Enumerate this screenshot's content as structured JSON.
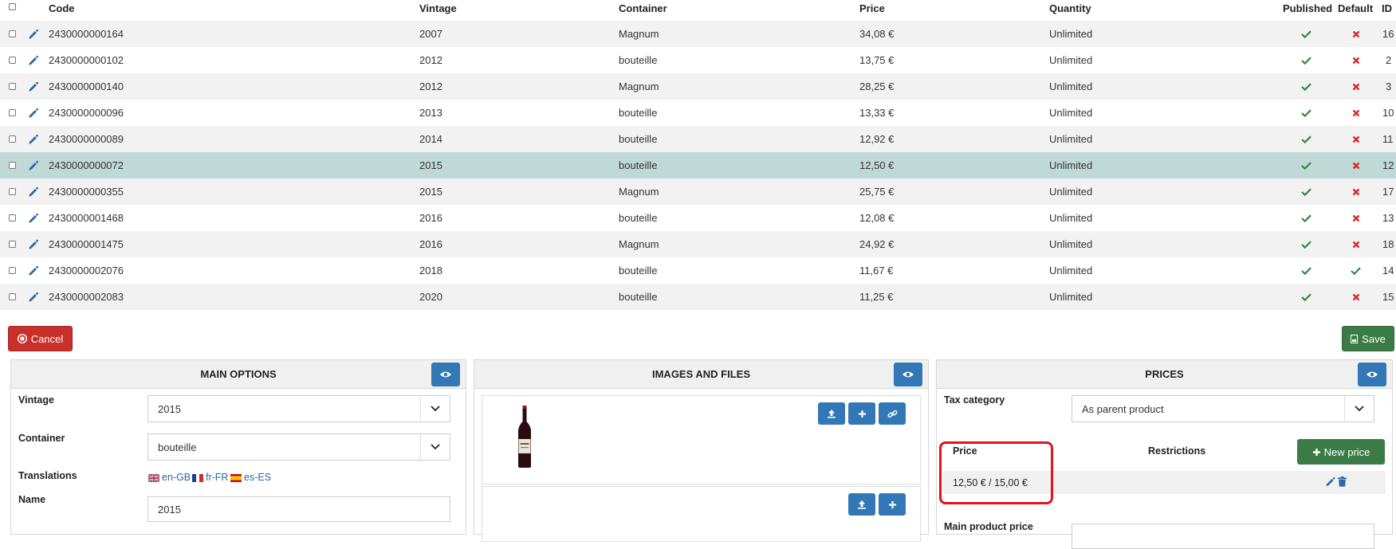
{
  "table": {
    "headers": {
      "code": "Code",
      "vintage": "Vintage",
      "container": "Container",
      "price": "Price",
      "quantity": "Quantity",
      "published": "Published",
      "default": "Default",
      "id": "ID"
    },
    "rows": [
      {
        "code": "2430000000164",
        "vintage": "2007",
        "container": "Magnum",
        "price": "34,08 €",
        "quantity": "Unlimited",
        "published": true,
        "default": false,
        "id": "16"
      },
      {
        "code": "2430000000102",
        "vintage": "2012",
        "container": "bouteille",
        "price": "13,75 €",
        "quantity": "Unlimited",
        "published": true,
        "default": false,
        "id": "2"
      },
      {
        "code": "2430000000140",
        "vintage": "2012",
        "container": "Magnum",
        "price": "28,25 €",
        "quantity": "Unlimited",
        "published": true,
        "default": false,
        "id": "3"
      },
      {
        "code": "2430000000096",
        "vintage": "2013",
        "container": "bouteille",
        "price": "13,33 €",
        "quantity": "Unlimited",
        "published": true,
        "default": false,
        "id": "10"
      },
      {
        "code": "2430000000089",
        "vintage": "2014",
        "container": "bouteille",
        "price": "12,92 €",
        "quantity": "Unlimited",
        "published": true,
        "default": false,
        "id": "11"
      },
      {
        "code": "2430000000072",
        "vintage": "2015",
        "container": "bouteille",
        "price": "12,50 €",
        "quantity": "Unlimited",
        "published": true,
        "default": false,
        "id": "12",
        "selected": true
      },
      {
        "code": "2430000000355",
        "vintage": "2015",
        "container": "Magnum",
        "price": "25,75 €",
        "quantity": "Unlimited",
        "published": true,
        "default": false,
        "id": "17"
      },
      {
        "code": "2430000001468",
        "vintage": "2016",
        "container": "bouteille",
        "price": "12,08 €",
        "quantity": "Unlimited",
        "published": true,
        "default": false,
        "id": "13"
      },
      {
        "code": "2430000001475",
        "vintage": "2016",
        "container": "Magnum",
        "price": "24,92 €",
        "quantity": "Unlimited",
        "published": true,
        "default": false,
        "id": "18"
      },
      {
        "code": "2430000002076",
        "vintage": "2018",
        "container": "bouteille",
        "price": "11,67 €",
        "quantity": "Unlimited",
        "published": true,
        "default": true,
        "id": "14"
      },
      {
        "code": "2430000002083",
        "vintage": "2020",
        "container": "bouteille",
        "price": "11,25 €",
        "quantity": "Unlimited",
        "published": true,
        "default": false,
        "id": "15"
      }
    ]
  },
  "actions": {
    "cancel_label": "Cancel",
    "save_label": "Save"
  },
  "main_options": {
    "title": "MAIN OPTIONS",
    "vintage_label": "Vintage",
    "vintage_value": "2015",
    "container_label": "Container",
    "container_value": "bouteille",
    "translations_label": "Translations",
    "languages": [
      "en-GB",
      "fr-FR",
      "es-ES"
    ],
    "name_label": "Name",
    "name_value": "2015"
  },
  "images": {
    "title": "IMAGES AND FILES"
  },
  "prices": {
    "title": "PRICES",
    "tax_label": "Tax category",
    "tax_value": "As parent product",
    "col_price": "Price",
    "col_restrictions": "Restrictions",
    "new_price_label": "New price",
    "price_value": "12,50 € / 15,00 €",
    "main_product_price_label": "Main product price"
  },
  "colors": {
    "primary": "#3277b6",
    "success": "#3b7b46",
    "danger": "#c9302c",
    "check": "#2e8b3e",
    "cross": "#d9262b",
    "selected_row": "#bfdad6",
    "highlight": "#e3141c"
  }
}
